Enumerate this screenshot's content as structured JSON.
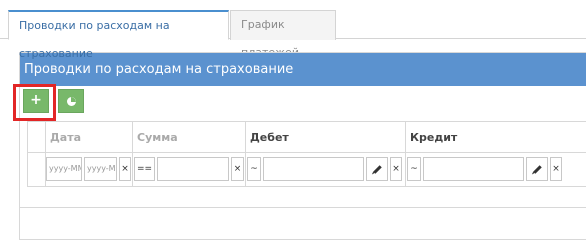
{
  "tabs": [
    {
      "label": "Проводки по расходам на страхование",
      "active": true
    },
    {
      "label": "График платежей",
      "active": false
    }
  ],
  "panel": {
    "title": "Проводки по расходам на страхование",
    "header_color": "#5b92cf"
  },
  "toolbar": {
    "add_label": "+",
    "add_icon": "plus-icon",
    "chart_icon": "pie-chart-icon",
    "button_color": "#78b86a"
  },
  "grid": {
    "columns": [
      {
        "label": ""
      },
      {
        "label": "Дата"
      },
      {
        "label": "Сумма"
      },
      {
        "label": "Дебет"
      },
      {
        "label": "Кредит"
      }
    ],
    "filters": {
      "date_from_placeholder": "yyyy-MM-dd",
      "date_to_placeholder": "yyyy-MM-dd",
      "sum_operator": "==",
      "debit_operator": "~",
      "credit_operator": "~",
      "clear": "×"
    }
  },
  "highlight_color": "#e22626"
}
